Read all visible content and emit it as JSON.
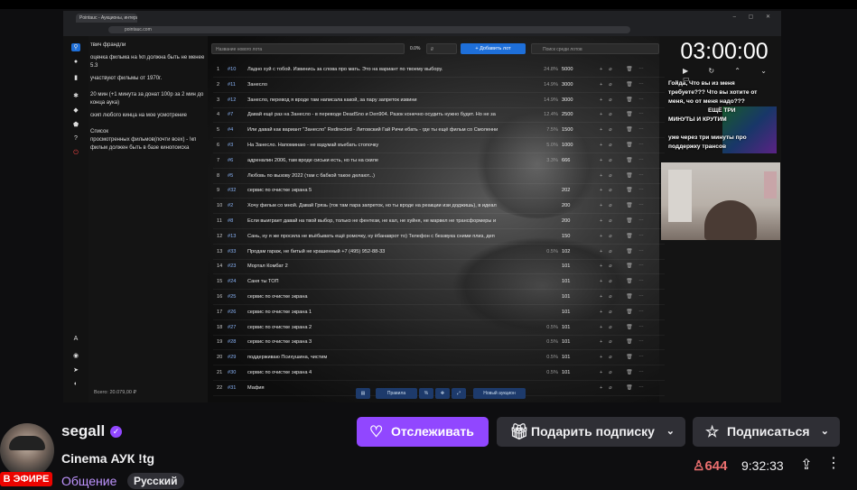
{
  "browser": {
    "tab_title": "Pointauc - Аукционы, интерак...",
    "address": "pointauc.com"
  },
  "left_panel": {
    "lines": [
      "твич франдли",
      "оценка фильма на !кп должна быть не менее 5.3",
      "участвуют фильмы от 1970г.",
      "20 мин (+1 минута за донат 100р за 2 мин до конца аука)",
      "скип любого кинца на мое усмотрение",
      "Список",
      "просмотренных фильмов(почти всех) - !кп фильм должен быть в базе кинопоиска"
    ]
  },
  "auction": {
    "lot_placeholder": "Название нового лота",
    "percent": "0.0%",
    "amount_placeholder": "₽",
    "add_button": "+ Добавить лот",
    "search_placeholder": "Поиск среди лотов",
    "rows": [
      {
        "num": "1",
        "id": "#10",
        "name": "Ладно хуй с тобой. Извинись за слова про мать. Это на вариант по твоему выбору.",
        "pct": "24.8%",
        "amount": "5000"
      },
      {
        "num": "2",
        "id": "#11",
        "name": "Занесло",
        "pct": "14.9%",
        "amount": "3000"
      },
      {
        "num": "3",
        "id": "#12",
        "name": "Занесло, перевод я вроде там написала какой, за пару запреток извини",
        "pct": "14.9%",
        "amount": "3000"
      },
      {
        "num": "4",
        "id": "#7",
        "name": "Давай ещё раз на Занесло - в переводе DeadSno и Den904. Разок конечно осудить нужно будет. Но не за",
        "pct": "12.4%",
        "amount": "2500"
      },
      {
        "num": "5",
        "id": "#4",
        "name": "Или давай как вариант \"Занесло\" Redirected - Литовский Гай Ричи ебать - где ты ещё фильм со Смоленни",
        "pct": "7.5%",
        "amount": "1500"
      },
      {
        "num": "6",
        "id": "#3",
        "name": "На Занесло. Напоминаю - не вздумай въебать стопочку",
        "pct": "5.0%",
        "amount": "1000"
      },
      {
        "num": "7",
        "id": "#6",
        "name": "адреналин 2006, там вроде сиськи есть, но ты на скиле",
        "pct": "3.3%",
        "amount": "666"
      },
      {
        "num": "8",
        "id": "#5",
        "name": "Любовь по вызову 2022 (там с бабкой такое делают...)",
        "pct": "",
        "amount": ""
      },
      {
        "num": "9",
        "id": "#32",
        "name": "сервис по очистке экрана 5",
        "pct": "",
        "amount": "202"
      },
      {
        "num": "10",
        "id": "#2",
        "name": "Хочу фильм со мной. Давай Грязь (ток там пара запреток, но ты вроде на реакции изи доджишь), в идеал",
        "pct": "",
        "amount": "200"
      },
      {
        "num": "11",
        "id": "#8",
        "name": "Если выиграет давай на твой выбор, только не фентези, не кал, не хуйня, не марвел не трансформеры и",
        "pct": "",
        "amount": "200"
      },
      {
        "num": "12",
        "id": "#13",
        "name": "Сань, ну я же просила не въёбывать ещё ромочку, ну ёбанаврот то)  Телефон с беззвука сними плиз, деп",
        "pct": "",
        "amount": "150"
      },
      {
        "num": "13",
        "id": "#33",
        "name": "Продам гараж, не битый не крашенный +7 (495) 952-88-33",
        "pct": "0.5%",
        "amount": "102"
      },
      {
        "num": "14",
        "id": "#23",
        "name": "Мортал Комбат 2",
        "pct": "",
        "amount": "101"
      },
      {
        "num": "15",
        "id": "#24",
        "name": "Саня ты ТОП",
        "pct": "",
        "amount": "101"
      },
      {
        "num": "16",
        "id": "#25",
        "name": "сервис по очистке экрана",
        "pct": "",
        "amount": "101"
      },
      {
        "num": "17",
        "id": "#26",
        "name": "сервис по очистке экрана 1",
        "pct": "",
        "amount": "101"
      },
      {
        "num": "18",
        "id": "#27",
        "name": "сервис по очистке экрана 2",
        "pct": "0.5%",
        "amount": "101"
      },
      {
        "num": "19",
        "id": "#28",
        "name": "сервис по очистке экрана 3",
        "pct": "0.5%",
        "amount": "101"
      },
      {
        "num": "20",
        "id": "#29",
        "name": "поддерживаю Психушина, чистим",
        "pct": "0.5%",
        "amount": "101"
      },
      {
        "num": "21",
        "id": "#30",
        "name": "сервис по очистке экрана 4",
        "pct": "0.5%",
        "amount": "101"
      },
      {
        "num": "22",
        "id": "#31",
        "name": "Мафия",
        "pct": "",
        "amount": ""
      }
    ],
    "total": "Всего: 20.079,00 ₽",
    "bottom": {
      "rules": "Правила",
      "pct": "%",
      "new_auction": "Новый аукцион"
    }
  },
  "timer": {
    "value": "03:00:00"
  },
  "chat_overlay": {
    "lines": [
      "Гойда, Что вы из меня",
      "требуете??? Что вы хотите от",
      "меня, чо от меня надо???",
      "ЕЩЁ   ТРИ",
      "МИНУТЫ   И КРУТИМ",
      "уже через три минуты про",
      "поддержку трансов"
    ]
  },
  "channel": {
    "name": "segall",
    "live_label": "В ЭФИРЕ",
    "stream_title": "Cinema АУК !tg",
    "category": "Общение",
    "tag": "Русский",
    "follow_label": "Отслеживать",
    "gift_label": "Подарить подписку",
    "subscribe_label": "Подписаться",
    "viewers": "644",
    "uptime": "9:32:33"
  },
  "colors": {
    "accent": "#9147ff",
    "live": "#eb0400",
    "viewers": "#eb6f6f",
    "category": "#bf94ff"
  }
}
